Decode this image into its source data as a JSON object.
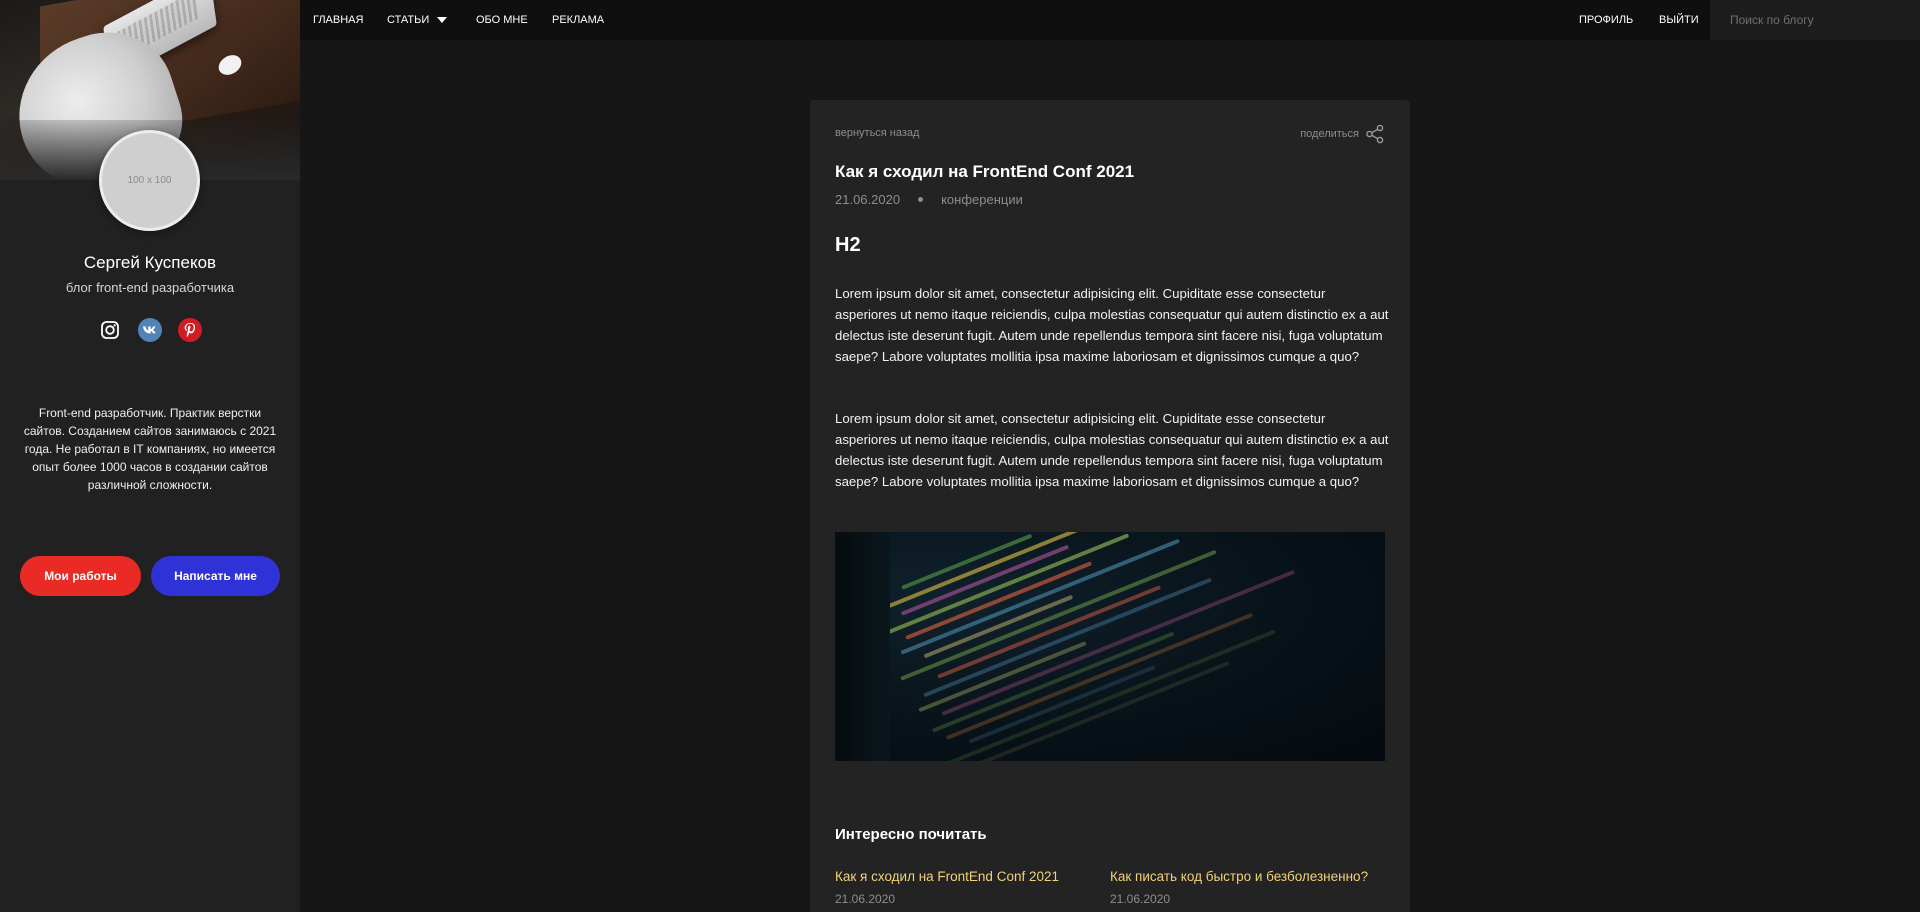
{
  "nav": {
    "items": [
      {
        "label": "ГЛАВНАЯ"
      },
      {
        "label": "СТАТЬИ"
      },
      {
        "label": "ОБО МНЕ"
      },
      {
        "label": "РЕКЛАМА"
      }
    ],
    "profile": "ПРОФИЛЬ",
    "logout": "ВЫЙТИ",
    "search_placeholder": "Поиск по блогу"
  },
  "sidebar": {
    "avatar_placeholder": "100 x 100",
    "name": "Сергей Куспеков",
    "subtitle": "блог front-end разработчика",
    "socials": [
      {
        "icon": "instagram-icon"
      },
      {
        "icon": "vk-icon"
      },
      {
        "icon": "pinterest-icon"
      }
    ],
    "about": "Front-end разработчик. Практик верстки сайтов. Созданием сайтов занимаюсь с 2021 года. Не работал в IT компаниях, но имеется опыт более 1000 часов в создании сайтов различной сложности.",
    "btn_works": "Мои работы",
    "btn_write": "Написать мне"
  },
  "article": {
    "back": "вернуться назад",
    "share": "поделиться",
    "title": "Как я сходил на FrontEnd Conf 2021",
    "date": "21.06.2020",
    "category": "конференции",
    "heading": "H2",
    "p1": "Lorem ipsum dolor sit amet, consectetur adipisicing elit. Cupiditate esse consectetur asperiores ut nemo itaque reiciendis, culpa molestias consequatur qui autem distinctio ex a aut delectus iste deserunt fugit. Autem unde repellendus tempora sint facere nisi, fuga voluptatum saepe? Labore voluptates mollitia ipsa maxime laboriosam et dignissimos cumque a quo?",
    "p2": "Lorem ipsum dolor sit amet, consectetur adipisicing elit. Cupiditate esse consectetur asperiores ut nemo itaque reiciendis, culpa molestias consequatur qui autem distinctio ex a aut delectus iste deserunt fugit. Autem unde repellendus tempora sint facere nisi, fuga voluptatum saepe? Labore voluptates mollitia ipsa maxime laboriosam et dignissimos cumque a quo?"
  },
  "related": {
    "title": "Интересно почитать",
    "items": [
      {
        "title": "Как я сходил на FrontEnd Conf 2021",
        "date": "21.06.2020"
      },
      {
        "title": "Как писать код быстро и безболезненно?",
        "date": "21.06.2020"
      }
    ]
  },
  "colors": {
    "accent_red": "#ea2a25",
    "accent_blue": "#2f32d7",
    "link_yellow": "#f0d27a"
  }
}
